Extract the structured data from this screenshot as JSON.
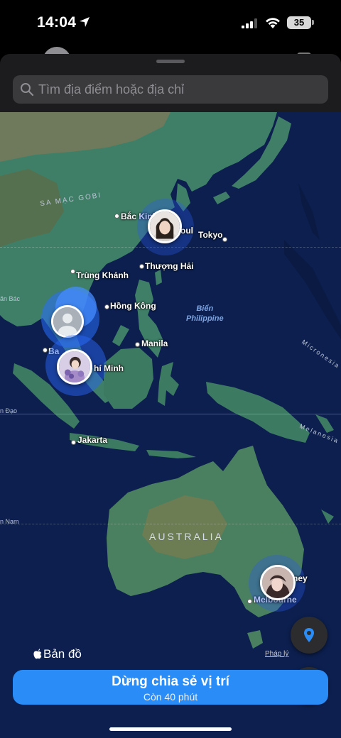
{
  "status_bar": {
    "time": "14:04",
    "battery": "35"
  },
  "search": {
    "placeholder": "Tìm địa điểm hoặc địa chỉ"
  },
  "map": {
    "cities": [
      {
        "name": "Bắc Kinh"
      },
      {
        "name": "Tokyo"
      },
      {
        "name": "Thượng Hải"
      },
      {
        "name": "Trùng Khánh"
      },
      {
        "name": "Hồng Kông"
      },
      {
        "name": "Manila"
      },
      {
        "name": "Jakarta"
      },
      {
        "name": "Melbourne"
      },
      {
        "name": "oul"
      },
      {
        "name": "hí Minh"
      },
      {
        "name": "ney"
      }
    ],
    "regions": {
      "gobi": "SA MẠC GOBI",
      "sea": "Biển\nPhilippine",
      "micronesia": "Micronesia",
      "melanesia": "Melanesia",
      "australia": "AUSTRALIA",
      "west_edge_1": "n Đạo",
      "west_edge_2": "n Nam",
      "west_edge_3": "ăn Bác",
      "west_edge_4": "Ba"
    },
    "friends": [
      {
        "label": "friend-seoul"
      },
      {
        "label": "friend-bangkok"
      },
      {
        "label": "friend-hcm"
      },
      {
        "label": "friend-sydney"
      }
    ]
  },
  "map_controls": {
    "pin_button": "location-pin-icon",
    "locate_button": "navigation-arrow-icon"
  },
  "footer": {
    "brand": "Bản đồ",
    "legal": "Pháp lý"
  },
  "share_button": {
    "title": "Dừng chia sẻ vị trí",
    "subtitle": "Còn 40 phút"
  },
  "colors": {
    "accent": "#2a8cf6",
    "ocean": "#0c1f4e",
    "land": "#3f7f67"
  }
}
